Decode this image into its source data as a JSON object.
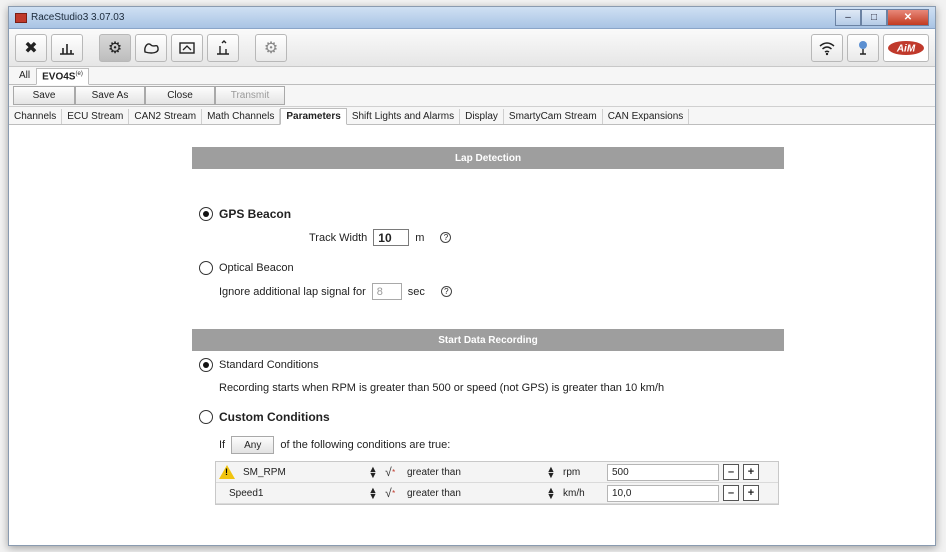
{
  "window": {
    "title": "RaceStudio3 3.07.03"
  },
  "toolbar": {
    "icons": [
      "tools-icon",
      "chart-icon",
      "gear-icon",
      "track-icon",
      "dashboard-icon",
      "download-icon",
      "settings-icon"
    ],
    "right_icons": [
      "wifi-icon",
      "network-icon",
      "aim-logo"
    ]
  },
  "device_tabs": {
    "all": "All",
    "device": "EVO4S",
    "device_sup": "(e)"
  },
  "actions": {
    "save": "Save",
    "save_as": "Save As",
    "close": "Close",
    "transmit": "Transmit"
  },
  "section_tabs": [
    "Channels",
    "ECU Stream",
    "CAN2 Stream",
    "Math Channels",
    "Parameters",
    "Shift Lights and Alarms",
    "Display",
    "SmartyCam Stream",
    "CAN Expansions"
  ],
  "active_section": "Parameters",
  "lap_detection": {
    "header": "Lap Detection",
    "gps_beacon": "GPS Beacon",
    "track_width_label": "Track Width",
    "track_width_value": "10",
    "track_width_unit": "m",
    "optical_beacon": "Optical Beacon",
    "ignore_label": "Ignore additional lap signal for",
    "ignore_value": "8",
    "ignore_unit": "sec",
    "help_glyph": "?"
  },
  "start_recording": {
    "header": "Start Data Recording",
    "standard": "Standard Conditions",
    "standard_desc": "Recording starts when RPM is greater than 500 or speed (not GPS) is greater than 10 km/h",
    "custom": "Custom Conditions",
    "if_label": "If",
    "any_label": "Any",
    "conditions_label": "of the following conditions are true:",
    "conditions": [
      {
        "channel": "SM_RPM",
        "operator": "greater than",
        "unit": "rpm",
        "value": "500",
        "warning": true
      },
      {
        "channel": "Speed1",
        "operator": "greater than",
        "unit": "km/h",
        "value": "10,0",
        "warning": false
      }
    ]
  }
}
